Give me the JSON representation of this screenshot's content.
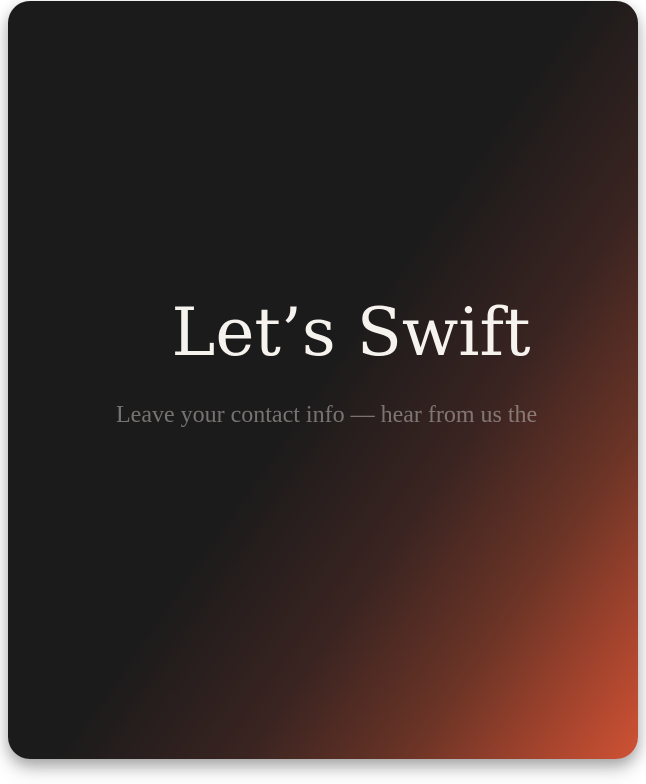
{
  "hero": {
    "title": "Let’s Swift",
    "subtitle": "Leave your contact info — hear from us the"
  },
  "colors": {
    "background_dark": "#1c1b1b",
    "gradient_accent": "#cf5234",
    "title_text": "#f6f3ef",
    "subtitle_text": "#8f8b87"
  }
}
